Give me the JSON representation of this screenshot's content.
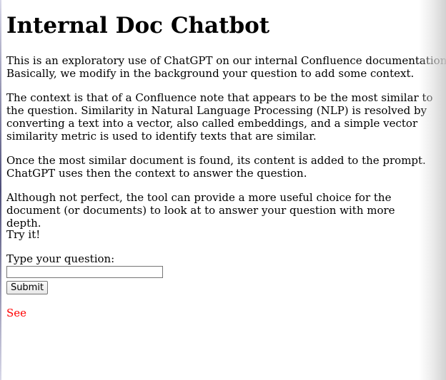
{
  "header": {
    "title": "Internal Doc Chatbot"
  },
  "intro": {
    "paragraph_1": "This is an exploratory use of ChatGPT on our internal Confluence documentation. Basically, we modify in the background your question to add some context.",
    "paragraph_2": "The context is that of a Confluence note that appears to be the most similar to the question. Similarity in Natural Language Processing (NLP) is resolved by converting a text into a vector, also called embeddings, and a simple vector similarity metric is used to identify texts that are similar.",
    "paragraph_3": "Once the most similar document is found, its content is added to the prompt. ChatGPT uses then the context to answer the question.",
    "paragraph_4": "Although not perfect, the tool can provide a more useful choice for the document (or documents) to look at to answer your question with more depth.",
    "try_it": "Try it!"
  },
  "form": {
    "question_label": "Type your question:",
    "question_value": "",
    "submit_label": "Submit"
  },
  "result": {
    "see_link": "See"
  },
  "colors": {
    "link": "#ff0000",
    "text": "#000000"
  }
}
